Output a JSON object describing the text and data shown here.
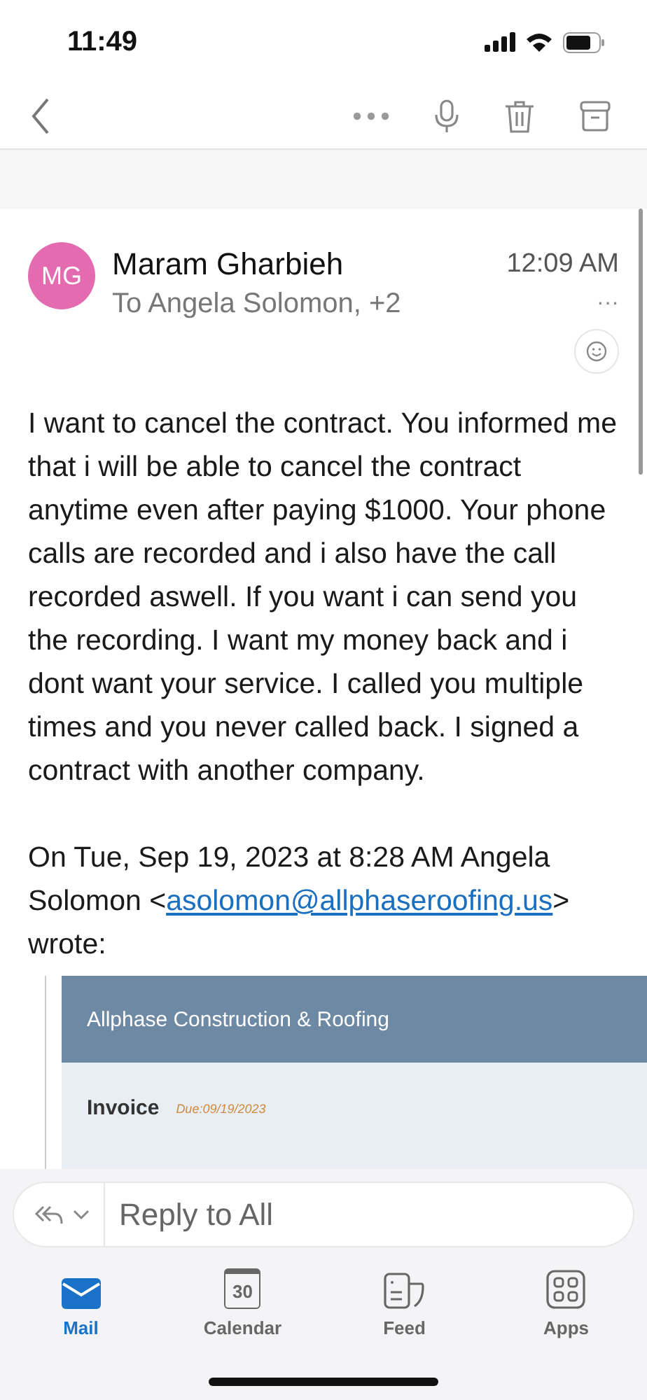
{
  "status_bar": {
    "time": "11:49"
  },
  "message": {
    "avatar": {
      "initials": "MG",
      "color": "#e46bb0"
    },
    "sender": "Maram Gharbieh",
    "recipients": "To Angela Solomon, +2",
    "time": "12:09 AM",
    "more": "···",
    "body": "I want to cancel the contract. You informed me that i will be able to cancel the contract anytime even after paying $1000. Your phone calls are recorded and i also have the call recorded aswell. If you want i can send you the recording. I want my money back and i dont want your service. I called you multiple times and you never called back. I signed a contract with another company.",
    "quote_intro": "On Tue, Sep 19, 2023 at 8:28 AM Angela Solomon <",
    "quote_email": "asolomon@allphaseroofing.us",
    "quote_outro": "> wrote:",
    "quoted": {
      "company": "Allphase Construction & Roofing",
      "invoice_label": "Invoice",
      "due": "Due:09/19/2023"
    }
  },
  "reply_bar": {
    "placeholder": "Reply to All"
  },
  "tabs": [
    {
      "label": "Mail",
      "kind": "mail",
      "selected": true
    },
    {
      "label": "Calendar",
      "kind": "calendar",
      "icon_text": "30",
      "selected": false
    },
    {
      "label": "Feed",
      "kind": "feed",
      "selected": false
    },
    {
      "label": "Apps",
      "kind": "apps",
      "selected": false
    }
  ]
}
